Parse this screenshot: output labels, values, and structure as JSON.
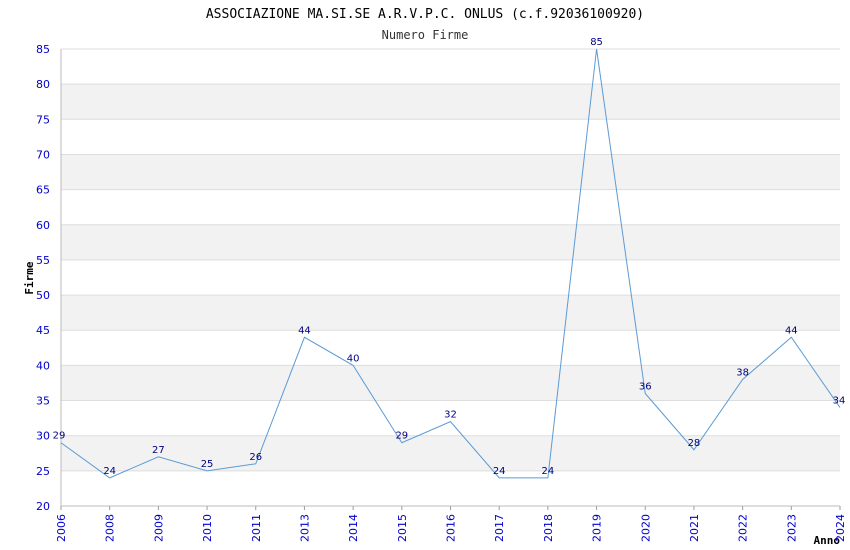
{
  "chart_data": {
    "type": "line",
    "title": "ASSOCIAZIONE MA.SI.SE A.R.V.P.C. ONLUS (c.f.92036100920)",
    "subtitle": "Numero Firme",
    "xlabel": "Anno",
    "ylabel": "Firme",
    "ylim": [
      20,
      85
    ],
    "y_ticks": [
      20,
      25,
      30,
      35,
      40,
      45,
      50,
      55,
      60,
      65,
      70,
      75,
      80,
      85
    ],
    "grid": "horizontal bands",
    "categories": [
      "2006",
      "2008",
      "2009",
      "2010",
      "2011",
      "2013",
      "2014",
      "2015",
      "2016",
      "2017",
      "2018",
      "2019",
      "2020",
      "2021",
      "2022",
      "2023",
      "2024"
    ],
    "series": [
      {
        "values": [
          29,
          24,
          27,
          25,
          26,
          44,
          40,
          29,
          32,
          24,
          24,
          85,
          36,
          28,
          38,
          44,
          34
        ]
      }
    ],
    "colors": {
      "line": "#5b9bd5",
      "band": "#f2f2f2",
      "grid": "#dddddd",
      "tick_text": "#0000cc",
      "data_label": "#000080"
    }
  }
}
